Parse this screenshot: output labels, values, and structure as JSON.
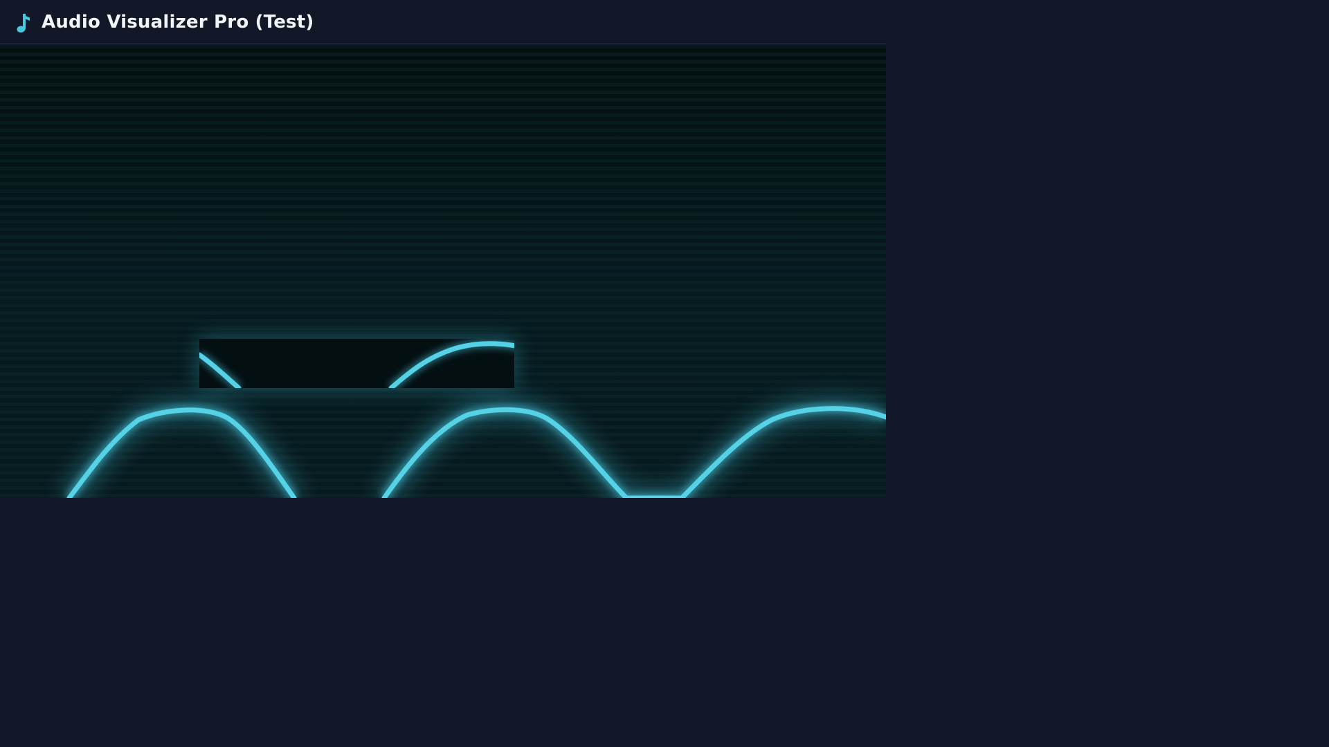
{
  "app": {
    "title": "Audio Visualizer Pro (Test)",
    "icon": "music-note-icon"
  },
  "visualizer": {
    "mode": "waveform",
    "accent_color": "#46c8df",
    "background_color": "#06151a"
  }
}
